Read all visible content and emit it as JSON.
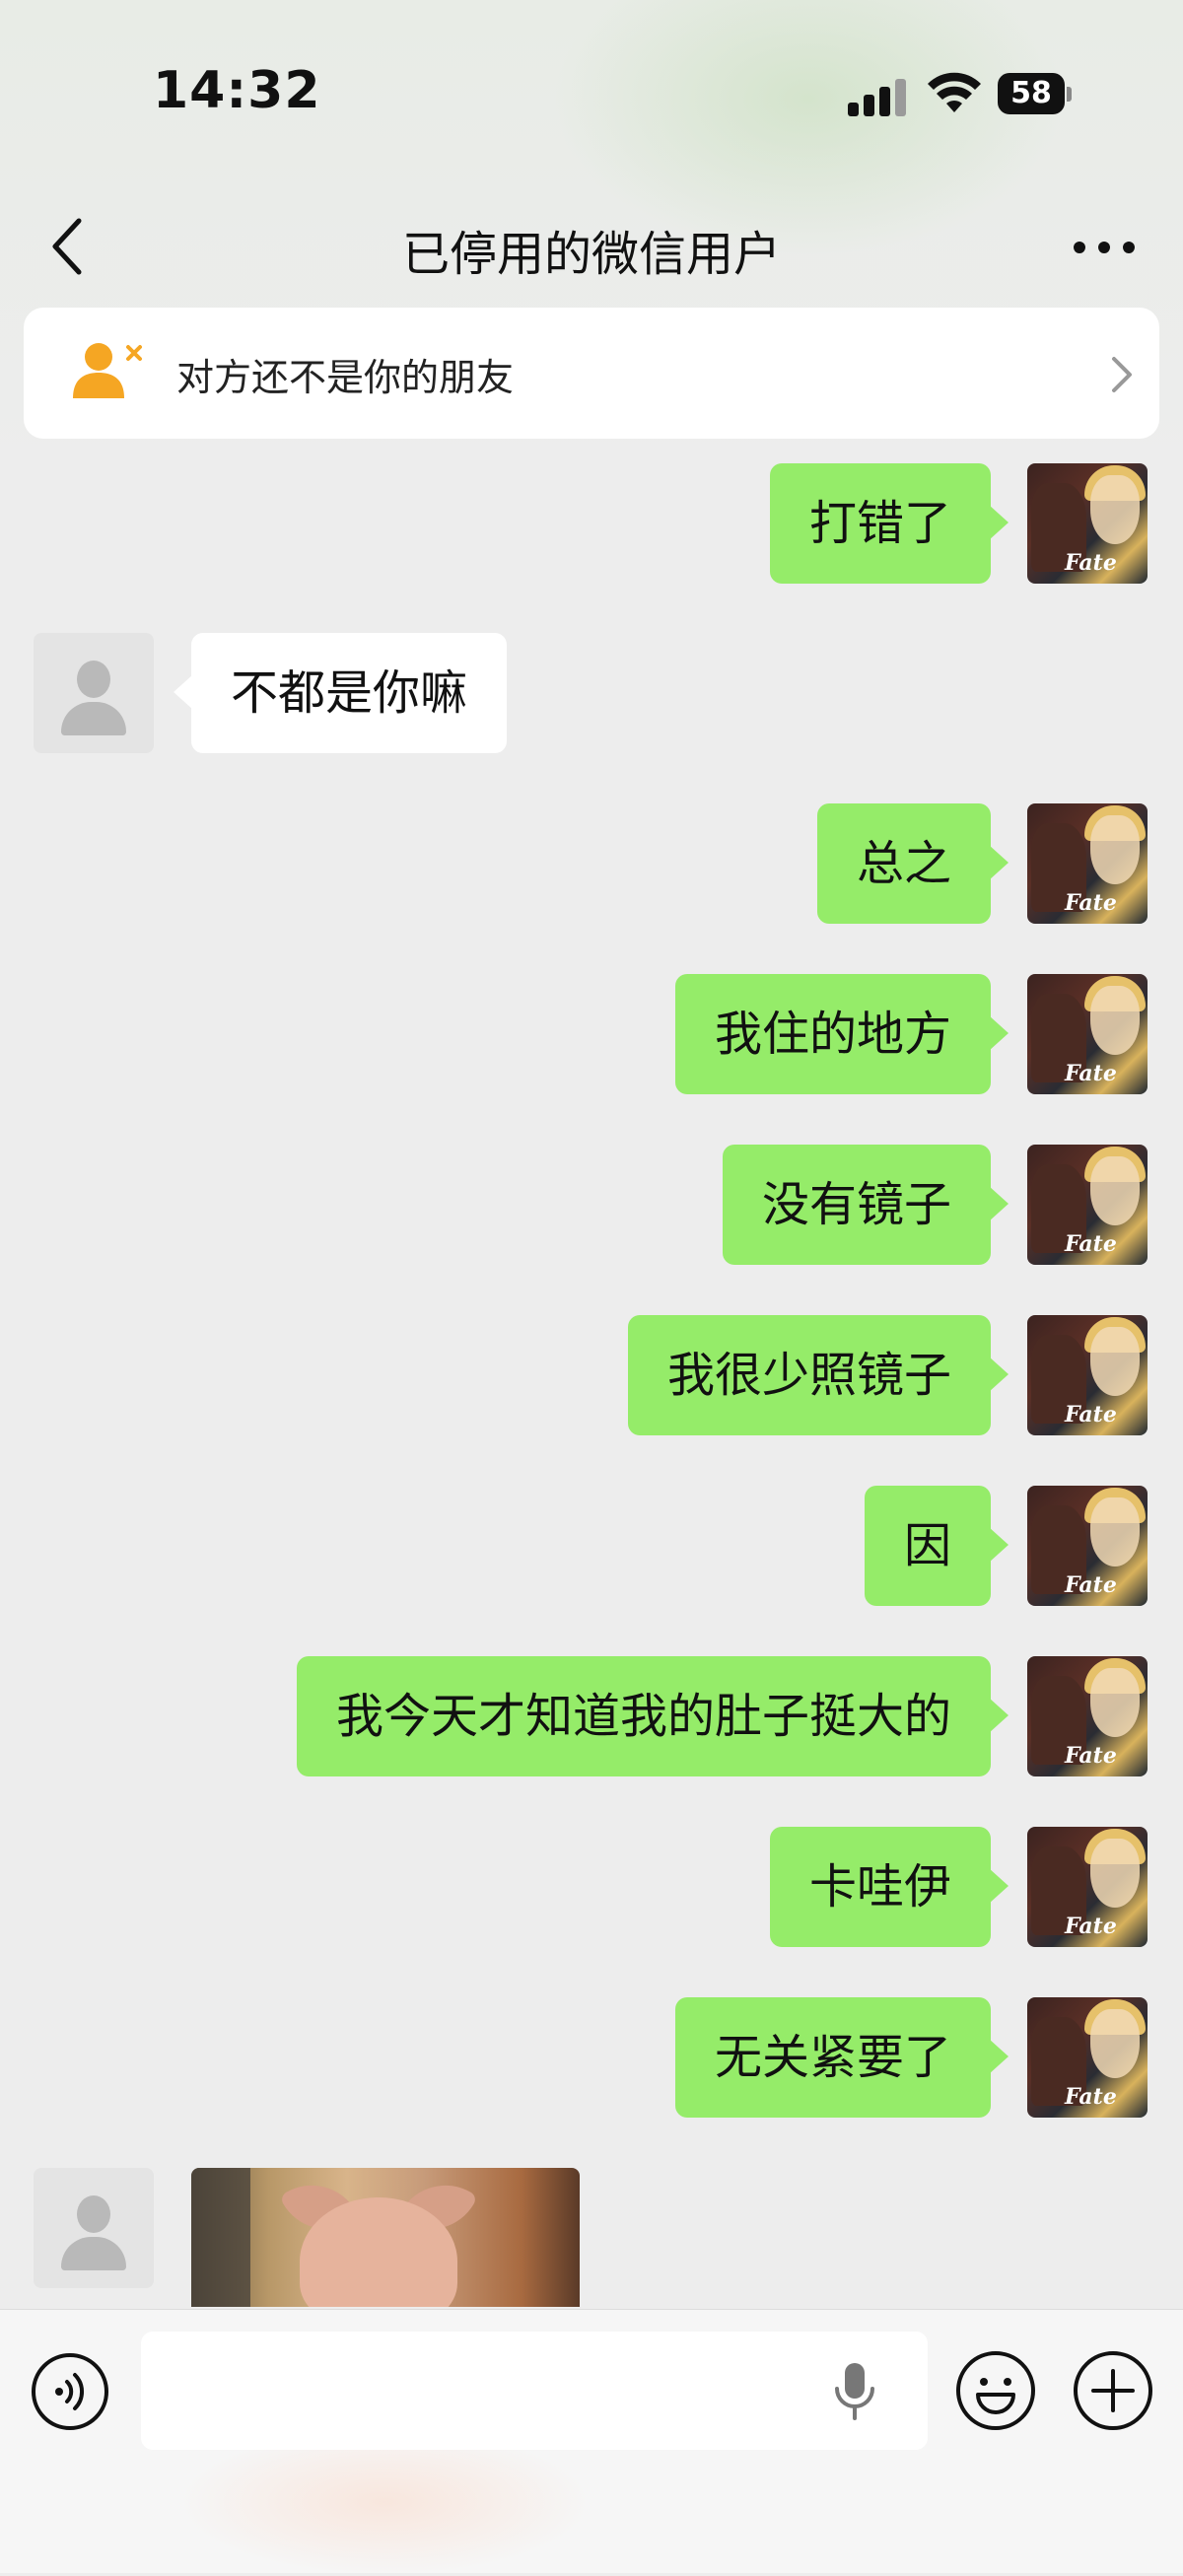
{
  "status_bar": {
    "time": "14:32",
    "battery": "58"
  },
  "nav": {
    "title": "已停用的微信用户"
  },
  "banner": {
    "text": "对方还不是你的朋友"
  },
  "messages": [
    {
      "from": "me",
      "text": "打错了"
    },
    {
      "from": "them",
      "text": "不都是你嘛"
    },
    {
      "from": "me",
      "text": "总之"
    },
    {
      "from": "me",
      "text": "我住的地方"
    },
    {
      "from": "me",
      "text": "没有镜子"
    },
    {
      "from": "me",
      "text": "我很少照镜子"
    },
    {
      "from": "me",
      "text": "因"
    },
    {
      "from": "me",
      "text": "我今天才知道我的肚子挺大的"
    },
    {
      "from": "me",
      "text": "卡哇伊"
    },
    {
      "from": "me",
      "text": "无关紧要了"
    },
    {
      "from": "them",
      "type": "image"
    }
  ],
  "avatar_logo": "Fate",
  "input": {
    "value": ""
  },
  "icons": {
    "back": "chevron-left-icon",
    "more": "more-dots-icon",
    "banner": "user-remove-icon",
    "voice": "voice-mode-icon",
    "mic": "microphone-icon",
    "emoji": "emoji-icon",
    "plus": "plus-icon"
  },
  "colors": {
    "my_bubble": "#95ec69",
    "their_bubble": "#ffffff",
    "background": "#ededed",
    "accent": "#f5a623"
  }
}
